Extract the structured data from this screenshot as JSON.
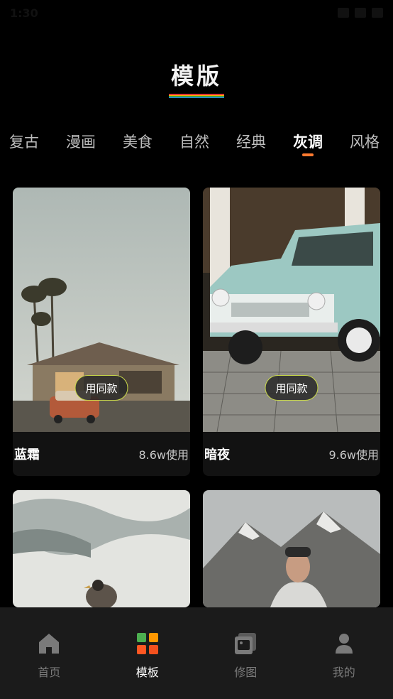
{
  "status": {
    "time": "1:30"
  },
  "header": {
    "title": "模版"
  },
  "tabs": [
    {
      "label": "复古",
      "active": false
    },
    {
      "label": "漫画",
      "active": false
    },
    {
      "label": "美食",
      "active": false
    },
    {
      "label": "自然",
      "active": false
    },
    {
      "label": "经典",
      "active": false
    },
    {
      "label": "灰调",
      "active": true
    },
    {
      "label": "风格",
      "active": false
    }
  ],
  "cards": [
    {
      "name": "蓝霜",
      "usage": "8.6w使用",
      "button_label": "用同款"
    },
    {
      "name": "暗夜",
      "usage": "9.6w使用",
      "button_label": "用同款"
    },
    {
      "name": "",
      "usage": "",
      "button_label": ""
    },
    {
      "name": "",
      "usage": "",
      "button_label": ""
    }
  ],
  "bottom_nav": [
    {
      "label": "首页",
      "icon": "home-icon",
      "active": false
    },
    {
      "label": "模板",
      "icon": "template-grid-icon",
      "active": true
    },
    {
      "label": "修图",
      "icon": "photo-edit-icon",
      "active": false
    },
    {
      "label": "我的",
      "icon": "profile-icon",
      "active": false
    }
  ],
  "colors": {
    "accent": "#ff7a2f",
    "button_border": "#c8d84a",
    "rainbow": [
      "#e53935",
      "#ffb300",
      "#43a047",
      "#1e88e5"
    ]
  }
}
